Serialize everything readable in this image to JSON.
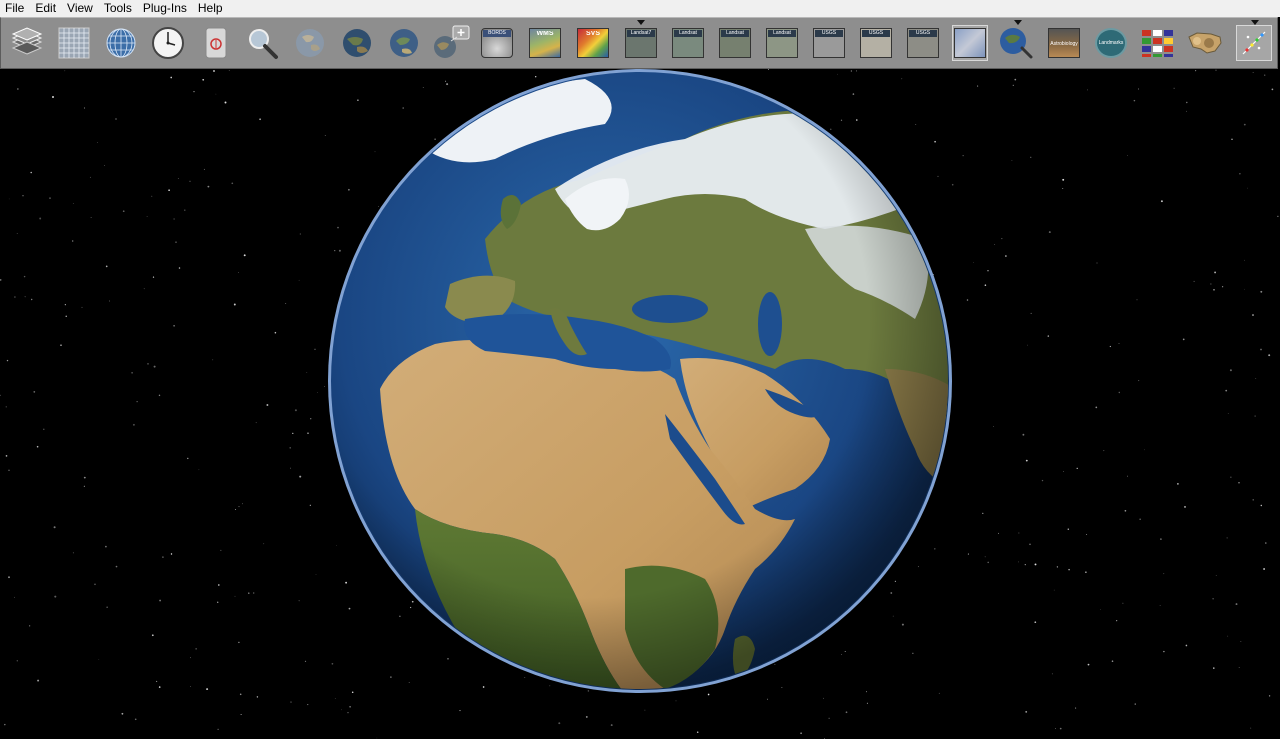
{
  "menu": {
    "items": [
      "File",
      "Edit",
      "View",
      "Tools",
      "Plug-Ins",
      "Help"
    ]
  },
  "toolbar": {
    "tile_labels": {
      "nasa_blue_marble": "BORDS",
      "wms": "WMS",
      "svs": "SVS",
      "landsat_1": "Landsat7",
      "landsat_2": "Landsat",
      "landsat_3": "Landsat",
      "landsat_4": "Landsat",
      "usgs_1": "USGS",
      "usgs_2": "USGS",
      "usgs_3": "USGS",
      "astrobiology": "Astrobiology",
      "landmarks": "Landmarks"
    }
  },
  "colors": {
    "menubar_bg": "#f0f0f0",
    "toolbar_bg": "#8e8e8e",
    "space": "#000000",
    "ocean": "#1d4f8c",
    "desert": "#c9a56d",
    "vegetation": "#4f6b2a",
    "snow": "#eef2f6",
    "atmosphere": "#7ea6e0"
  }
}
